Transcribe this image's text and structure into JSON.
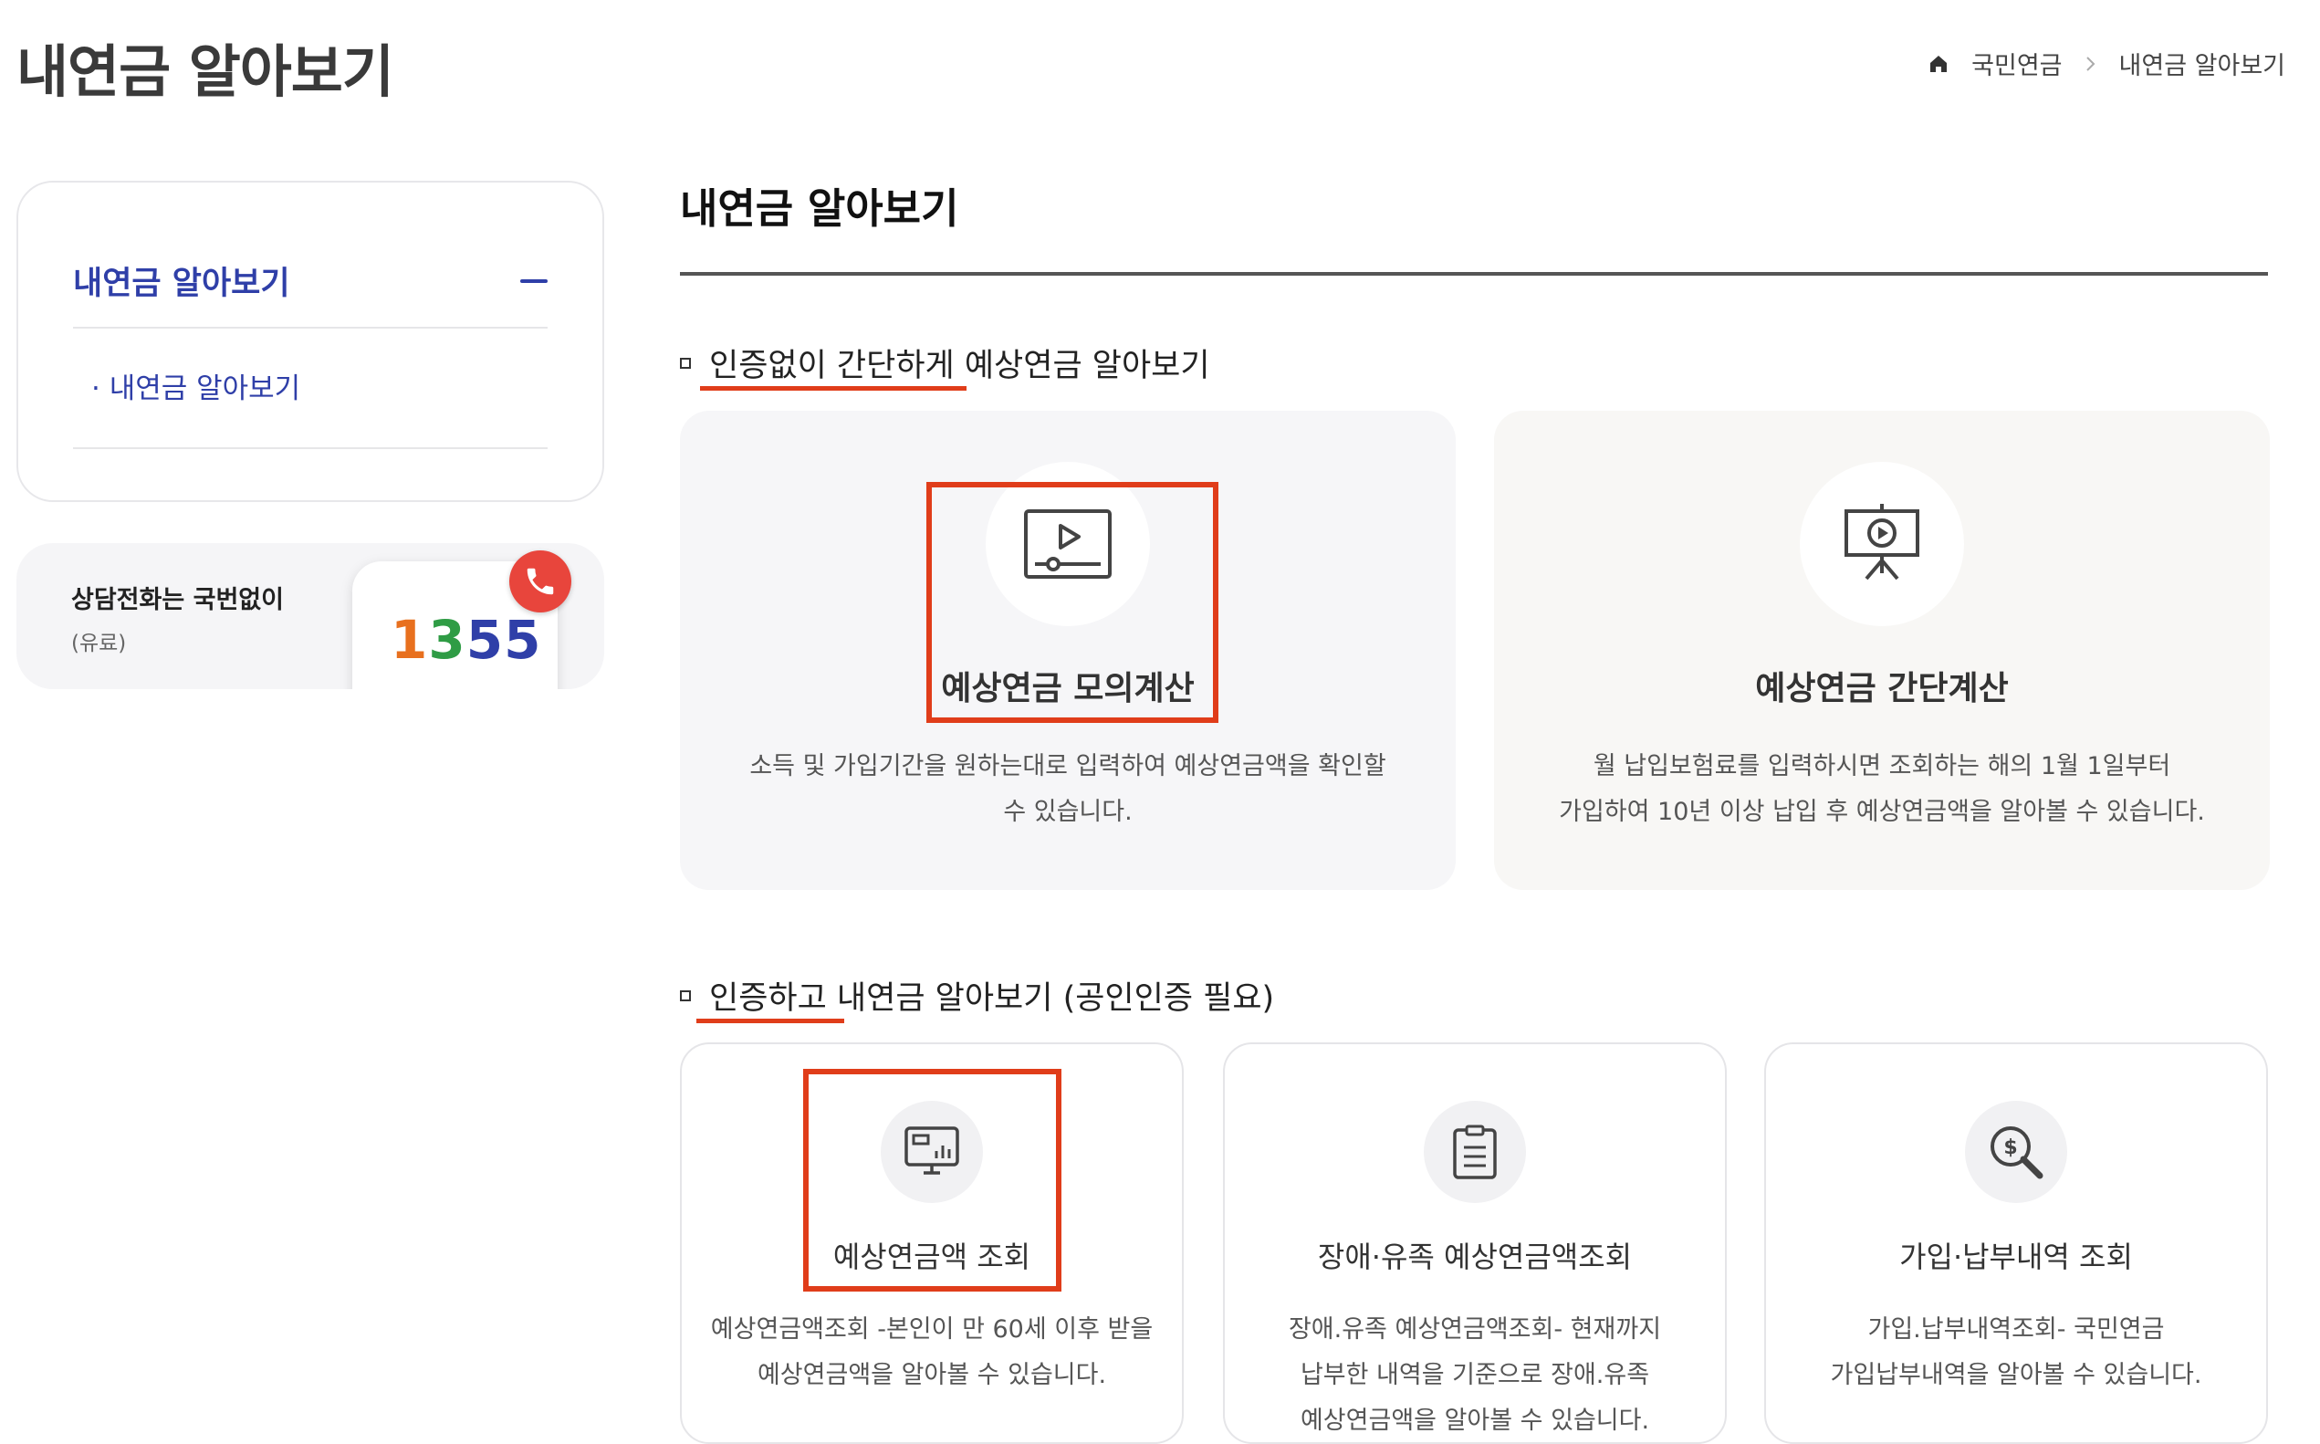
{
  "header": {
    "page_title": "내연금 알아보기",
    "breadcrumb": [
      "국민연금",
      "내연금 알아보기"
    ]
  },
  "sidebar": {
    "menu_title": "내연금 알아보기",
    "items": [
      {
        "label": "· 내연금 알아보기"
      }
    ]
  },
  "consult": {
    "title": "상담전화는 국번없이",
    "note": "(유료)",
    "number": "1355",
    "number_colors": [
      "#e8701e",
      "#2f9c45",
      "#2f3fa8",
      "#2f3fa8"
    ]
  },
  "main": {
    "title": "내연금 알아보기",
    "section1": {
      "heading": "인증없이 간단하게 예상연금 알아보기",
      "cards": [
        {
          "icon": "video-play-icon",
          "title": "예상연금 모의계산",
          "desc": [
            "소득 및 가입기간을 원하는대로 입력하여 예상연금액을 확인할",
            "수 있습니다."
          ]
        },
        {
          "icon": "presentation-play-icon",
          "title": "예상연금 간단계산",
          "desc": [
            "월 납입보험료를 입력하시면 조회하는 해의 1월 1일부터",
            "가입하여 10년 이상 납입 후 예상연금액을 알아볼 수 있습니다."
          ]
        }
      ]
    },
    "section2": {
      "heading": "인증하고 내연금 알아보기 (공인인증 필요)",
      "cards": [
        {
          "icon": "monitor-chart-icon",
          "title": "예상연금액 조회",
          "desc": [
            "예상연금액조회 -본인이 만 60세 이후 받을",
            "예상연금액을 알아볼 수 있습니다."
          ]
        },
        {
          "icon": "clipboard-list-icon",
          "title": "장애·유족 예상연금액조회",
          "desc": [
            "장애.유족 예상연금액조회- 현재까지",
            "납부한 내역을 기준으로 장애.유족",
            "예상연금액을 알아볼 수 있습니다."
          ]
        },
        {
          "icon": "dollar-search-icon",
          "title": "가입·납부내역 조회",
          "desc": [
            "가입.납부내역조회- 국민연금",
            "가입납부내역을 알아볼 수 있습니다."
          ]
        }
      ]
    }
  },
  "colors": {
    "accent_blue": "#2f3fa8",
    "highlight_red": "#e03d1a"
  }
}
